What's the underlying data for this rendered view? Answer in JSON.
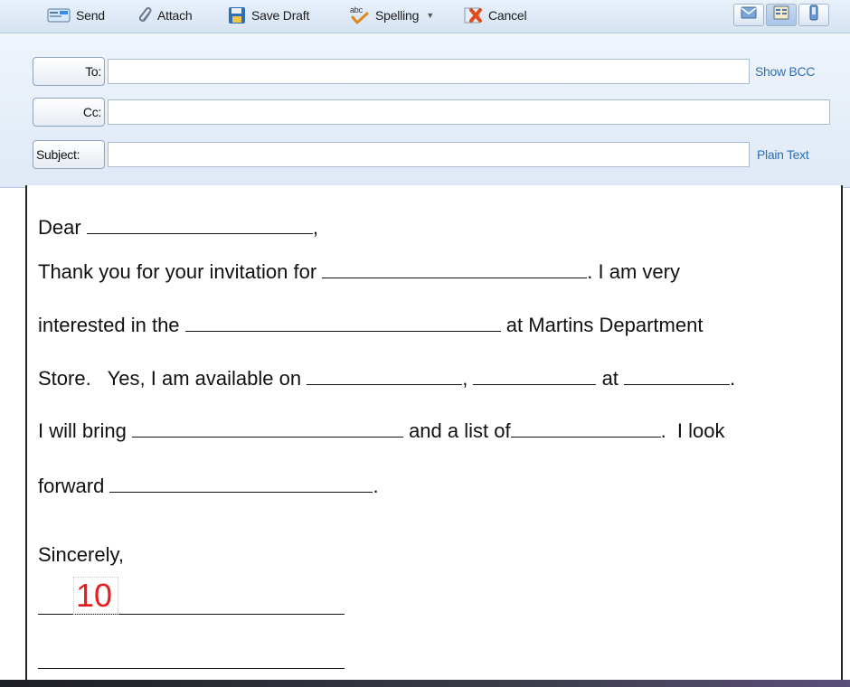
{
  "toolbar": {
    "send_label": "Send",
    "attach_label": "Attach",
    "save_draft_label": "Save Draft",
    "spelling_label": "Spelling",
    "cancel_label": "Cancel",
    "icons": {
      "send": "send-icon",
      "attach": "paperclip-icon",
      "save_draft": "floppy-disk-icon",
      "spelling": "spell-check-icon",
      "cancel": "cancel-icon",
      "view_mail": "envelope-icon",
      "view_contacts": "address-book-icon",
      "view_mobile": "phone-icon"
    }
  },
  "fields": {
    "to_label": "To:",
    "to_value": "",
    "show_bcc_label": "Show BCC",
    "cc_label": "Cc:",
    "cc_value": "",
    "subject_label": "Subject:",
    "subject_value": "",
    "plain_text_label": "Plain Text"
  },
  "letter": {
    "greeting": "Dear",
    "line1_a": "Thank you for your invitation for",
    "line1_b": ". I am very",
    "line2_a": "interested in the",
    "line2_b": "at Martins Department",
    "line3_a": "Store.   Yes, I am available on",
    "line3_b": "at",
    "line4_a": "I will bring",
    "line4_b": "and a list of",
    "line4_c": ".  I look",
    "line5_a": "forward",
    "closing": "Sincerely,",
    "score": "10"
  },
  "colors": {
    "link": "#2e6fb3",
    "score": "#e32020",
    "toolbar_bg": "#dfe9f5"
  }
}
